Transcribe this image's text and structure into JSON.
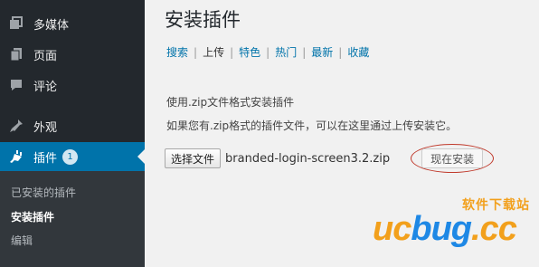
{
  "sidebar": {
    "items": [
      {
        "label": "多媒体",
        "icon": "media-icon"
      },
      {
        "label": "页面",
        "icon": "page-icon"
      },
      {
        "label": "评论",
        "icon": "comment-icon"
      },
      {
        "label": "外观",
        "icon": "appearance-icon"
      },
      {
        "label": "插件",
        "icon": "plugin-icon",
        "badge": "1"
      }
    ],
    "submenu": [
      "已安装的插件",
      "安装插件",
      "编辑"
    ],
    "active_color": "#0073aa"
  },
  "main": {
    "title": "安装插件",
    "filters": [
      "搜索",
      "上传",
      "特色",
      "热门",
      "最新",
      "收藏"
    ],
    "desc1": "使用.zip文件格式安装插件",
    "desc2": "如果您有.zip格式的插件文件，可以在这里通过上传安装它。",
    "choose_file_label": "选择文件",
    "file_name": "branded-login-screen3.2.zip",
    "install_label": "现在安装"
  },
  "watermark": {
    "sub": "软件下载站",
    "main_y": "uc",
    "main_b": "bug",
    "main_suffix": ".cc"
  }
}
